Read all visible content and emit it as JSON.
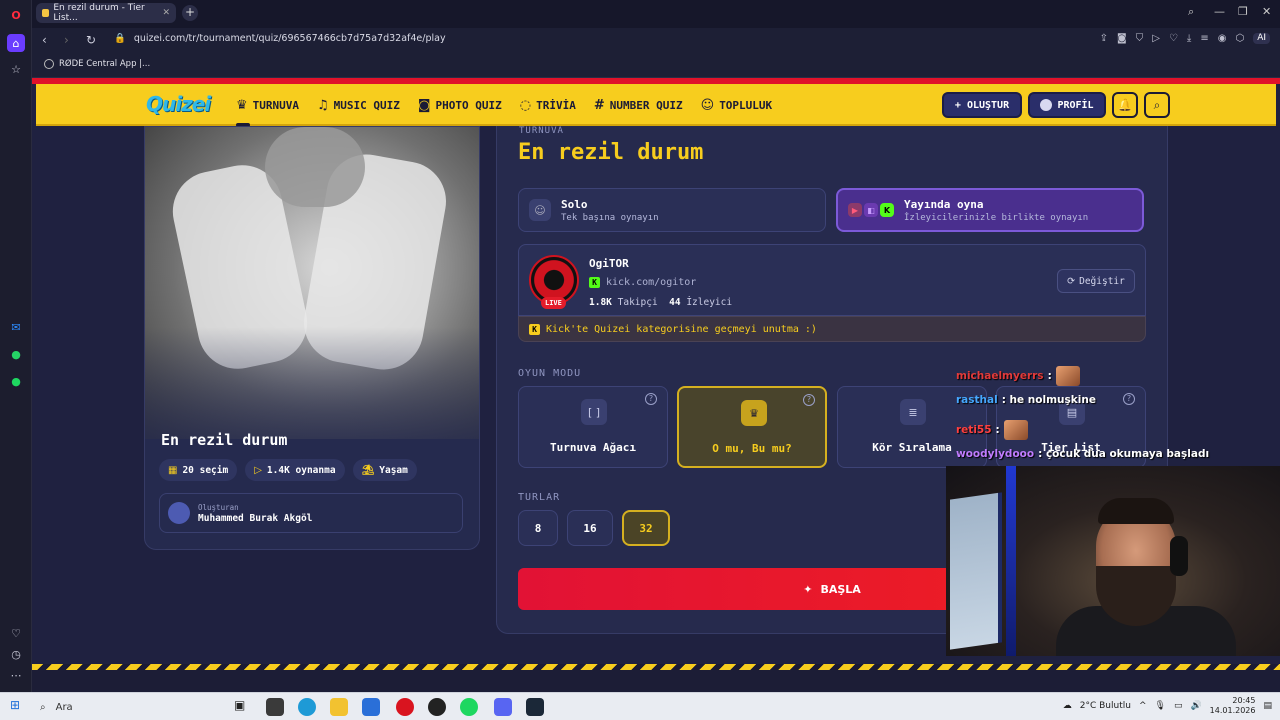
{
  "browser": {
    "tab_title": "En rezil durum - Tier List...",
    "url": "quizei.com/tr/tournament/quiz/696567466cb7d75a7d32af4e/play",
    "bookmark": "RØDE Central App |...",
    "ai_label": "AI"
  },
  "site": {
    "logo": "Quizei",
    "nav": [
      {
        "label": "TURNUVA",
        "icon": "trophy-icon"
      },
      {
        "label": "MUSIC QUIZ",
        "icon": "music-note-icon"
      },
      {
        "label": "PHOTO QUIZ",
        "icon": "camera-icon"
      },
      {
        "label": "TRİVİA",
        "icon": "chat-bubble-icon"
      },
      {
        "label": "NUMBER QUIZ",
        "icon": "hash-icon"
      },
      {
        "label": "TOPLULUK",
        "icon": "users-icon"
      }
    ],
    "create_label": "+ OLUŞTUR",
    "profile_label": "PROFİL"
  },
  "quiz_card": {
    "title": "En rezil durum",
    "chips": [
      {
        "label": "20 seçim",
        "icon": "grid-icon"
      },
      {
        "label": "1.4K oynanma",
        "icon": "play-icon"
      },
      {
        "label": "Yaşam",
        "icon": "palm-icon"
      }
    ],
    "creator_label": "Oluşturan",
    "creator_name": "Muhammed Burak Akgöl"
  },
  "panel": {
    "breadcrumb": "TURNUVA",
    "title": "En rezil durum",
    "solo": {
      "title": "Solo",
      "subtitle": "Tek başına oynayın"
    },
    "stream": {
      "title": "Yayında oyna",
      "subtitle": "İzleyicilerinizle birlikte oynayın"
    },
    "streamer": {
      "name": "OgiTOR",
      "channel": "kick.com/ogitor",
      "live": "LIVE",
      "followers": "1.8K",
      "followers_label": "Takipçi",
      "viewers": "44",
      "viewers_label": "İzleyici",
      "change_label": "Değiştir"
    },
    "notice": "Kick'te Quizei kategorisine geçmeyi unutma :)",
    "game_mode_label": "OYUN MODU",
    "game_modes": [
      {
        "label": "Turnuva Ağacı",
        "icon": "bracket-icon",
        "selected": false
      },
      {
        "label": "O mu, Bu mu?",
        "icon": "crown-icon",
        "selected": true
      },
      {
        "label": "Kör Sıralama",
        "icon": "list-icon",
        "selected": false
      },
      {
        "label": "Tier List",
        "icon": "tier-icon",
        "selected": false
      }
    ],
    "rounds_label": "TURLAR",
    "rounds": [
      "8",
      "16",
      "32"
    ],
    "selected_round": "32",
    "start_label": "BAŞLA"
  },
  "chat": [
    {
      "user": "michaelmyerrs",
      "message": ":",
      "color": "#e23a3a"
    },
    {
      "user": "rasthal",
      "message": ": he nolmuşkine",
      "color": "#46a8ff"
    },
    {
      "user": "reti55",
      "message": ":",
      "color": "#ff4040"
    },
    {
      "user": "woodylydooo",
      "message": ": çocuk dua okumaya başladı",
      "color": "#c07cff"
    }
  ],
  "taskbar": {
    "search": "Ara",
    "weather": "2°C Bulutlu",
    "time": "20:45",
    "date": "14.01.2026"
  },
  "colors": {
    "accent_yellow": "#f7cd1e",
    "start_red": "#e21235",
    "panel_bg": "#262a4d",
    "stream_purple": "#4a2f8e"
  }
}
